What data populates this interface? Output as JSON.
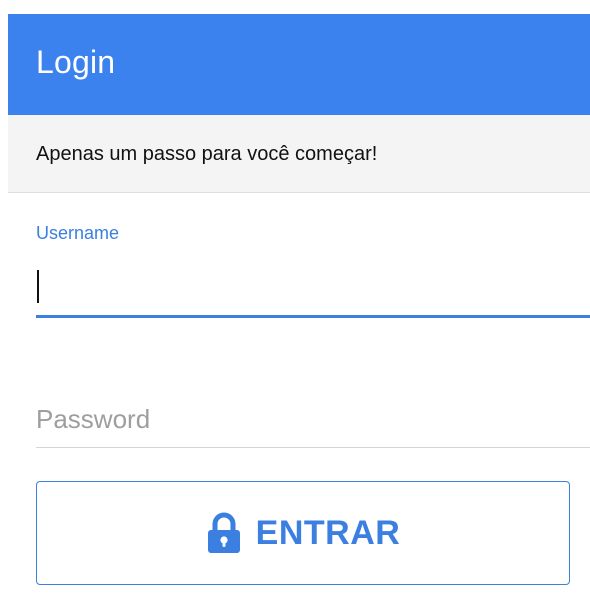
{
  "header": {
    "title": "Login"
  },
  "subheader": {
    "text": "Apenas um passo para você começar!"
  },
  "form": {
    "username": {
      "label": "Username",
      "value": ""
    },
    "password": {
      "placeholder": "Password",
      "value": ""
    },
    "submit": {
      "label": "ENTRAR",
      "icon": "lock-icon"
    }
  },
  "colors": {
    "primary": "#3b82ef",
    "accent": "#3b7fe0",
    "subheader_bg": "#f4f4f4",
    "placeholder": "#9e9e9e"
  }
}
